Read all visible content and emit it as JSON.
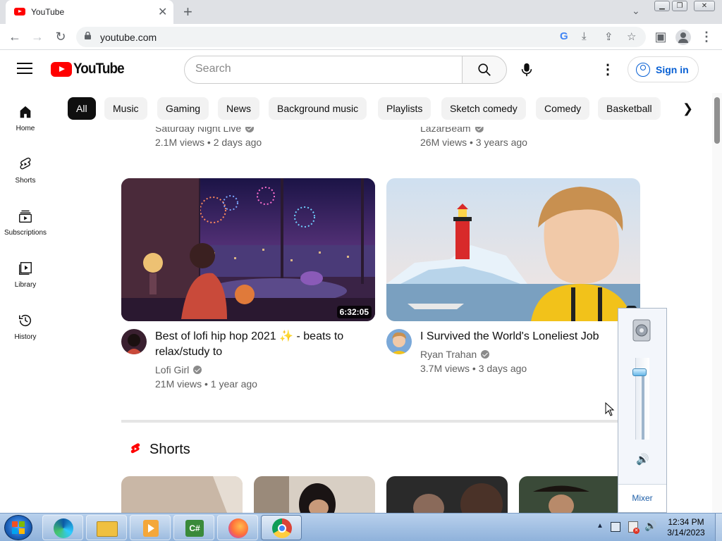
{
  "browser": {
    "tab_title": "YouTube",
    "url": "youtube.com"
  },
  "header": {
    "logo_text": "YouTube",
    "search_placeholder": "Search",
    "signin_label": "Sign in"
  },
  "chips": [
    "All",
    "Music",
    "Gaming",
    "News",
    "Background music",
    "Playlists",
    "Sketch comedy",
    "Comedy",
    "Basketball"
  ],
  "sidebar": [
    {
      "label": "Home",
      "icon": "home-icon"
    },
    {
      "label": "Shorts",
      "icon": "shorts-icon"
    },
    {
      "label": "Subscriptions",
      "icon": "subscriptions-icon"
    },
    {
      "label": "Library",
      "icon": "library-icon"
    },
    {
      "label": "History",
      "icon": "history-icon"
    }
  ],
  "partial_row": [
    {
      "channel": "Saturday Night Live",
      "stats": "2.1M views • 2 days ago"
    },
    {
      "channel": "LazarBeam",
      "stats": "26M views • 3 years ago"
    }
  ],
  "videos": [
    {
      "title_line1": "Best of lofi hip hop 2021 ✨ - beats to",
      "title_line2": "relax/study to",
      "channel": "Lofi Girl",
      "stats": "21M views • 1 year ago",
      "duration": "6:32:05"
    },
    {
      "title_line1": "I Survived the World's Loneliest Job",
      "channel": "Ryan Trahan",
      "stats": "3.7M views • 3 days ago",
      "duration": "1"
    }
  ],
  "shorts": {
    "heading": "Shorts"
  },
  "volume": {
    "mixer_label": "Mixer",
    "level": 0.82
  },
  "taskbar": {
    "time": "12:34 PM",
    "date": "3/14/2023"
  },
  "colors": {
    "brand_red": "#ff0000",
    "link_blue": "#065fd4"
  }
}
